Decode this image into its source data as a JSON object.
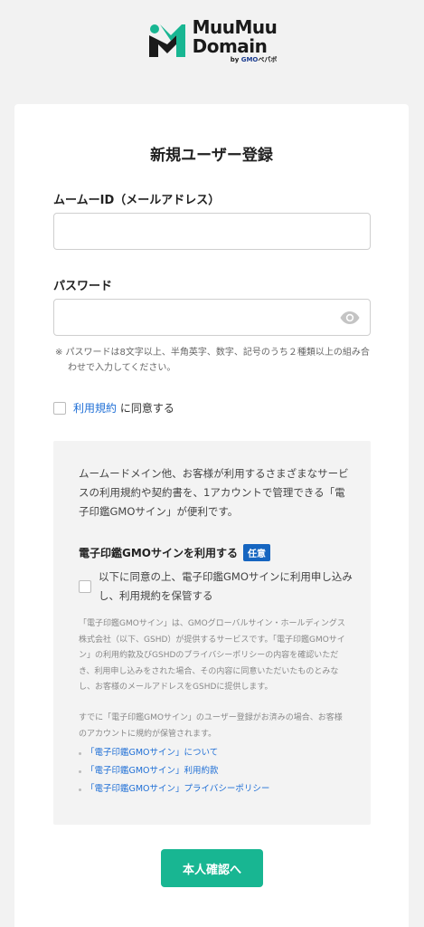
{
  "brand": {
    "line1": "MuuMuu",
    "line2": "Domain",
    "by_prefix": "by",
    "by_company": "GMO",
    "by_suffix": "ペパボ",
    "colors": {
      "green": "#18b692",
      "dark": "#1a1a1a",
      "gmo_blue": "#1b3c8f"
    }
  },
  "form": {
    "title": "新規ユーザー登録",
    "id_label": "ムームーID（メールアドレス）",
    "id_value": "",
    "password_label": "パスワード",
    "password_value": "",
    "password_note": "※ パスワードは8文字以上、半角英字、数字、記号のうち２種類以上の組み合わせで入力してください。",
    "terms_link": "利用規約",
    "terms_suffix": " に同意する"
  },
  "esign": {
    "promo": "ムームードメイン他、お客様が利用するさまざまなサービスの利用規約や契約書を、1アカウントで管理できる「電子印鑑GMOサイン」が便利です。",
    "option_title": "電子印鑑GMOサインを利用する",
    "option_badge": "任意",
    "consent_text": "以下に同意の上、電子印鑑GMOサインに利用申し込みし、利用規約を保管する",
    "fine1": "「電子印鑑GMOサイン」は、GMOグローバルサイン・ホールディングス株式会社（以下、GSHD）が提供するサービスです。「電子印鑑GMOサイン」の利用約款及びGSHDのプライバシーポリシーの内容を確認いただき、利用申し込みをされた場合、その内容に同意いただいたものとみなし、お客様のメールアドレスをGSHDに提供します。",
    "fine2": "すでに「電子印鑑GMOサイン」のユーザー登録がお済みの場合、お客様のアカウントに規約が保管されます。",
    "links": [
      "「電子印鑑GMOサイン」について",
      "「電子印鑑GMOサイン」利用約款",
      "「電子印鑑GMOサイン」プライバシーポリシー"
    ],
    "badge_color": "#1565c0"
  },
  "actions": {
    "submit_label": "本人確認へ"
  },
  "icons": {
    "eye": "eye-icon",
    "logo": "muumuu-logo-mark"
  }
}
